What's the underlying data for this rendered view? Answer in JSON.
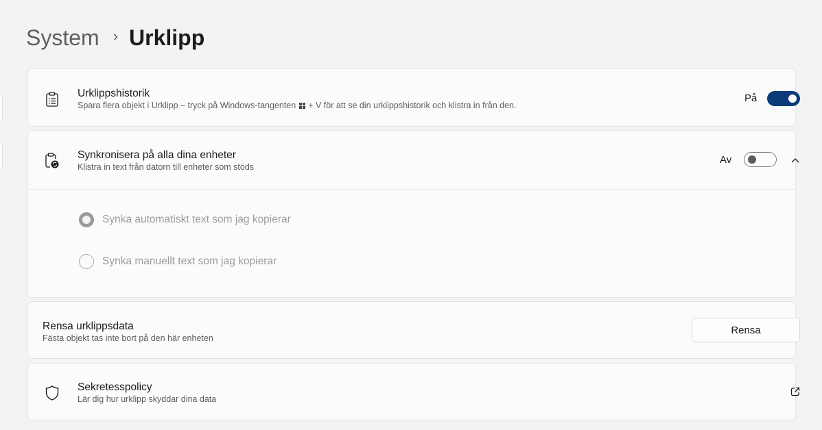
{
  "breadcrumb": {
    "parent": "System",
    "separator": "›",
    "current": "Urklipp"
  },
  "clipboard_history": {
    "title": "Urklippshistorik",
    "desc_before_key": "Spara flera objekt i Urklipp – tryck på Windows-tangenten",
    "desc_after_key": "+ V för att se din urklippshistorik och klistra in från den.",
    "state_label": "På",
    "enabled": true,
    "icon": "clipboard-list-icon"
  },
  "sync": {
    "title": "Synkronisera på alla dina enheter",
    "desc": "Klistra in text från datorn till enheter som stöds",
    "state_label": "Av",
    "enabled": false,
    "expanded": true,
    "icon": "clipboard-sync-icon",
    "options": [
      {
        "label": "Synka automatiskt text som jag kopierar",
        "selected": true
      },
      {
        "label": "Synka manuellt text som jag kopierar",
        "selected": false
      }
    ]
  },
  "clear_data": {
    "title": "Rensa urklippsdata",
    "desc": "Fästa objekt tas inte bort på den här enheten",
    "button_label": "Rensa"
  },
  "privacy": {
    "title": "Sekretesspolicy",
    "desc": "Lär dig hur urklipp skyddar dina data",
    "icon": "shield-icon",
    "link_icon": "open-external-icon"
  },
  "colors": {
    "accent": "#0b3b78",
    "background": "#f3f3f3",
    "card": "#fbfbfb"
  }
}
